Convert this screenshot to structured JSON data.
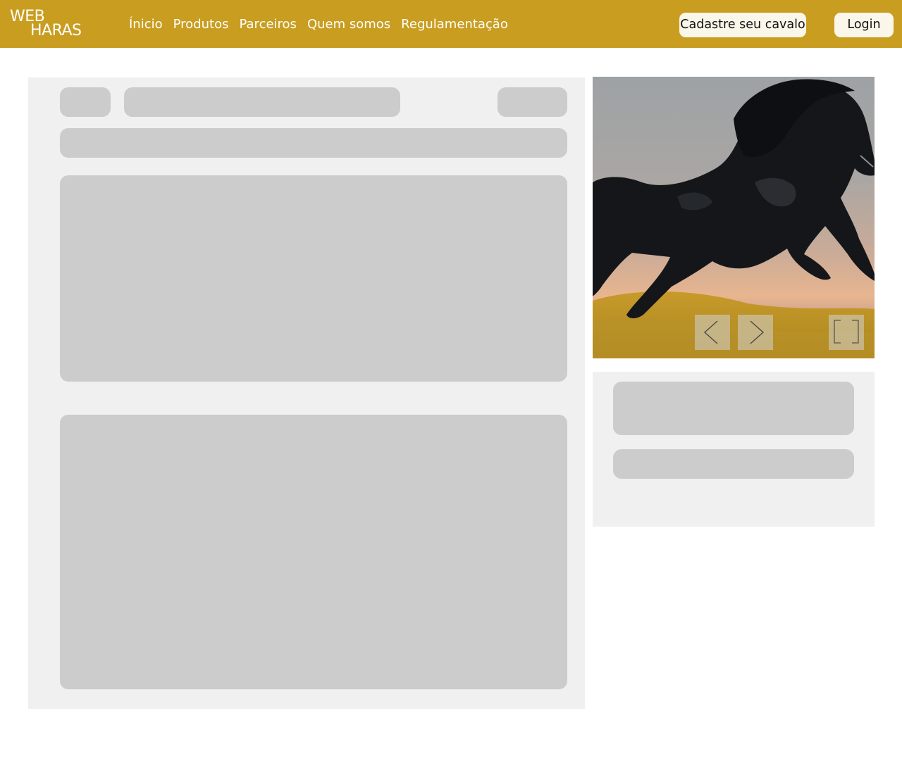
{
  "logo": {
    "line1": "WEB",
    "line2": "HARAS"
  },
  "nav": [
    {
      "label": "Ínicio"
    },
    {
      "label": "Produtos"
    },
    {
      "label": "Parceiros"
    },
    {
      "label": "Quem somos"
    },
    {
      "label": "Regulamentação"
    }
  ],
  "buttons": {
    "cadastre": "Cadastre seu cavalo",
    "login": "Login"
  },
  "colors": {
    "topbar": "#c99d20",
    "button_bg": "#fbf6ea",
    "panel_bg": "#f0f0f0",
    "placeholder": "#cccccc"
  },
  "gallery": {
    "icons": [
      "chevron-left-icon",
      "chevron-right-icon",
      "fullscreen-icon"
    ]
  }
}
